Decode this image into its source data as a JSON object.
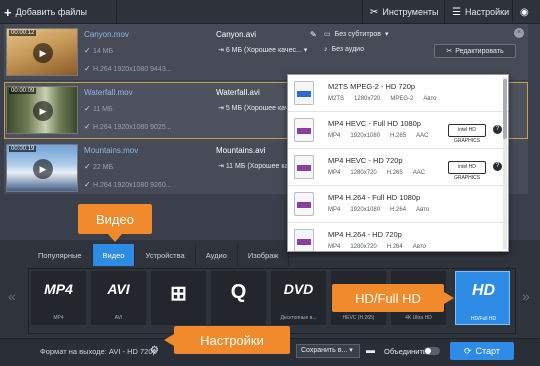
{
  "toolbar": {
    "add_files": "Добавить файлы",
    "tools": "Инструменты",
    "settings": "Настройки"
  },
  "files": [
    {
      "duration": "00:00:12",
      "name": "Canyon.mov",
      "size": "14 МБ",
      "codec": "H.264 1920x1080 9443...",
      "out_name": "Canyon.avi",
      "out_size": "6 МБ (Хорошее качес...",
      "subtitles": "Без субтитров",
      "audio": "Без аудио",
      "edit": "Редактировать",
      "thumb_colors": [
        "#c79a57",
        "#8a5a2a",
        "#e2c28c"
      ]
    },
    {
      "duration": "00:00:09",
      "name": "Waterfall.mov",
      "size": "11 МБ",
      "codec": "H.264 1920x1080 9025...",
      "out_name": "Waterfall.avi",
      "out_size": "5 МБ (Хорошее качес...",
      "thumb_colors": [
        "#3a4a2e",
        "#6f7d55",
        "#c9d1b2"
      ]
    },
    {
      "duration": "00:00:19",
      "name": "Mountains.mov",
      "size": "22 МБ",
      "codec": "H.264 1920x1080 9260...",
      "out_name": "Mountains.avi",
      "out_size": "11 МБ (Хорошее качес...",
      "thumb_colors": [
        "#6fa3d8",
        "#e8eef4",
        "#44608a"
      ]
    }
  ],
  "presets": [
    {
      "title": "M2TS MPEG-2 - HD 720p",
      "specs": [
        "M2TS",
        "1280x720",
        "MPEG-2",
        "Авто"
      ],
      "intel": false
    },
    {
      "title": "MP4 HEVC - Full HD 1080p",
      "specs": [
        "MP4",
        "1920x1080",
        "H.265",
        "AAC"
      ],
      "intel": true
    },
    {
      "title": "MP4 HEVC - HD 720p",
      "specs": [
        "MP4",
        "1280x720",
        "H.265",
        "AAC"
      ],
      "intel": true
    },
    {
      "title": "MP4 H.264 - Full HD 1080p",
      "specs": [
        "MP4",
        "1920x1080",
        "H.264",
        "Авто"
      ],
      "intel": false
    },
    {
      "title": "MP4 H.264 - HD 720p",
      "specs": [
        "MP4",
        "1280x720",
        "H.264",
        "Авто"
      ],
      "intel": false
    }
  ],
  "intel_badge": "intel HD GRAPHICS",
  "tabs": [
    "Популярные",
    "Видео",
    "Устройства",
    "Аудио",
    "Изображ"
  ],
  "active_tab": "Видео",
  "formats": [
    {
      "logo": "MP4",
      "label": "MP4"
    },
    {
      "logo": "AVI",
      "label": "AVI"
    },
    {
      "logo": "⊞",
      "label": ""
    },
    {
      "logo": "Q",
      "label": ""
    },
    {
      "logo": "DVD",
      "label": "Десктопные в..."
    },
    {
      "logo": "",
      "label": "HEVC (H.265)"
    },
    {
      "logo": "",
      "label": "4K Ultra HD"
    },
    {
      "logo": "HD",
      "label": "HD/Full HD"
    }
  ],
  "bottom": {
    "output_format": "Формат на выходе: AVI - HD 720p",
    "save_to": "Сохранить в...",
    "merge": "Объединить",
    "start": "Старт"
  },
  "callouts": {
    "video": "Видео",
    "settings": "Настройки",
    "hd": "HD/Full HD"
  },
  "colors": {
    "accent": "#2e8be6",
    "callout": "#f08a2a",
    "selected_outline": "#c8a24a"
  }
}
